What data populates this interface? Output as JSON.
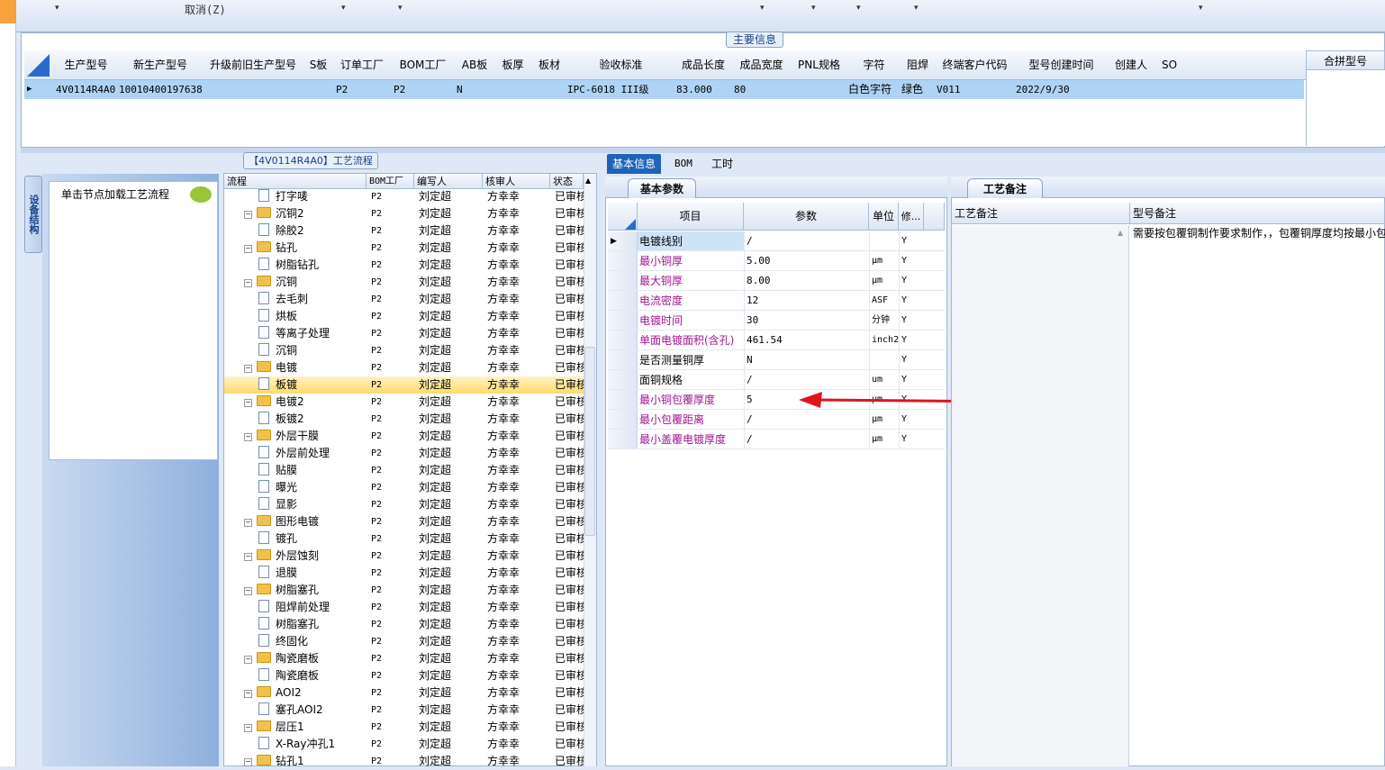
{
  "toolbar": {
    "cancel_label": "取消(Z)"
  },
  "main_info": {
    "title": "主要信息",
    "columns": [
      "生产型号",
      "新生产型号",
      "升级前旧生产型号",
      "S板",
      "订单工厂",
      "BOM工厂",
      "AB板",
      "板厚",
      "板材",
      "验收标准",
      "成品长度",
      "成品宽度",
      "PNL规格",
      "字符",
      "阻焊",
      "终端客户代码",
      "型号创建时间",
      "创建人",
      "SO"
    ],
    "row": {
      "prod_model": "4V0114R4A0",
      "new_prod_model": "10010400197638",
      "order_factory": "P2",
      "bom_factory": "P2",
      "ab_board": "N",
      "acceptance": "IPC-6018 III级",
      "length": "83.000",
      "width": "80",
      "char": "白色字符",
      "solder": "绿色",
      "customer_code": "V011",
      "created": "2022/9/30"
    },
    "merge_header": "合拼型号"
  },
  "process": {
    "title": "【4V0114R4A0】工艺流程",
    "device_tab": "设备结构",
    "load_hint": "单击节点加载工艺流程",
    "columns": [
      "流程",
      "BOM工厂",
      "编写人",
      "核审人",
      "状态"
    ],
    "rows": [
      {
        "name": "打字唛",
        "level": 2,
        "bom": "P2",
        "writer": "刘定超",
        "reviewer": "方幸幸",
        "status": "已审核"
      },
      {
        "name": "沉铜2",
        "level": 1,
        "bom": "P2",
        "writer": "刘定超",
        "reviewer": "方幸幸",
        "status": "已审核"
      },
      {
        "name": "除胶2",
        "level": 2,
        "bom": "P2",
        "writer": "刘定超",
        "reviewer": "方幸幸",
        "status": "已审核"
      },
      {
        "name": "钻孔",
        "level": 1,
        "bom": "P2",
        "writer": "刘定超",
        "reviewer": "方幸幸",
        "status": "已审核"
      },
      {
        "name": "树脂钻孔",
        "level": 2,
        "bom": "P2",
        "writer": "刘定超",
        "reviewer": "方幸幸",
        "status": "已审核"
      },
      {
        "name": "沉铜",
        "level": 1,
        "bom": "P2",
        "writer": "刘定超",
        "reviewer": "方幸幸",
        "status": "已审核"
      },
      {
        "name": "去毛刺",
        "level": 2,
        "bom": "P2",
        "writer": "刘定超",
        "reviewer": "方幸幸",
        "status": "已审核"
      },
      {
        "name": "烘板",
        "level": 2,
        "bom": "P2",
        "writer": "刘定超",
        "reviewer": "方幸幸",
        "status": "已审核"
      },
      {
        "name": "等离子处理",
        "level": 2,
        "bom": "P2",
        "writer": "刘定超",
        "reviewer": "方幸幸",
        "status": "已审核"
      },
      {
        "name": "沉铜",
        "level": 2,
        "bom": "P2",
        "writer": "刘定超",
        "reviewer": "方幸幸",
        "status": "已审核"
      },
      {
        "name": "电镀",
        "level": 1,
        "bom": "P2",
        "writer": "刘定超",
        "reviewer": "方幸幸",
        "status": "已审核"
      },
      {
        "name": "板镀",
        "level": 2,
        "bom": "P2",
        "writer": "刘定超",
        "reviewer": "方幸幸",
        "status": "已审核",
        "selected": true
      },
      {
        "name": "电镀2",
        "level": 1,
        "bom": "P2",
        "writer": "刘定超",
        "reviewer": "方幸幸",
        "status": "已审核"
      },
      {
        "name": "板镀2",
        "level": 2,
        "bom": "P2",
        "writer": "刘定超",
        "reviewer": "方幸幸",
        "status": "已审核"
      },
      {
        "name": "外层干膜",
        "level": 1,
        "bom": "P2",
        "writer": "刘定超",
        "reviewer": "方幸幸",
        "status": "已审核"
      },
      {
        "name": "外层前处理",
        "level": 2,
        "bom": "P2",
        "writer": "刘定超",
        "reviewer": "方幸幸",
        "status": "已审核"
      },
      {
        "name": "贴膜",
        "level": 2,
        "bom": "P2",
        "writer": "刘定超",
        "reviewer": "方幸幸",
        "status": "已审核"
      },
      {
        "name": "曝光",
        "level": 2,
        "bom": "P2",
        "writer": "刘定超",
        "reviewer": "方幸幸",
        "status": "已审核"
      },
      {
        "name": "显影",
        "level": 2,
        "bom": "P2",
        "writer": "刘定超",
        "reviewer": "方幸幸",
        "status": "已审核"
      },
      {
        "name": "图形电镀",
        "level": 1,
        "bom": "P2",
        "writer": "刘定超",
        "reviewer": "方幸幸",
        "status": "已审核"
      },
      {
        "name": "镀孔",
        "level": 2,
        "bom": "P2",
        "writer": "刘定超",
        "reviewer": "方幸幸",
        "status": "已审核"
      },
      {
        "name": "外层蚀刻",
        "level": 1,
        "bom": "P2",
        "writer": "刘定超",
        "reviewer": "方幸幸",
        "status": "已审核"
      },
      {
        "name": "退膜",
        "level": 2,
        "bom": "P2",
        "writer": "刘定超",
        "reviewer": "方幸幸",
        "status": "已审核"
      },
      {
        "name": "树脂塞孔",
        "level": 1,
        "bom": "P2",
        "writer": "刘定超",
        "reviewer": "方幸幸",
        "status": "已审核"
      },
      {
        "name": "阻焊前处理",
        "level": 2,
        "bom": "P2",
        "writer": "刘定超",
        "reviewer": "方幸幸",
        "status": "已审核"
      },
      {
        "name": "树脂塞孔",
        "level": 2,
        "bom": "P2",
        "writer": "刘定超",
        "reviewer": "方幸幸",
        "status": "已审核"
      },
      {
        "name": "终固化",
        "level": 2,
        "bom": "P2",
        "writer": "刘定超",
        "reviewer": "方幸幸",
        "status": "已审核"
      },
      {
        "name": "陶瓷磨板",
        "level": 1,
        "bom": "P2",
        "writer": "刘定超",
        "reviewer": "方幸幸",
        "status": "已审核"
      },
      {
        "name": "陶瓷磨板",
        "level": 2,
        "bom": "P2",
        "writer": "刘定超",
        "reviewer": "方幸幸",
        "status": "已审核"
      },
      {
        "name": "AOI2",
        "level": 1,
        "bom": "P2",
        "writer": "刘定超",
        "reviewer": "方幸幸",
        "status": "已审核"
      },
      {
        "name": "塞孔AOI2",
        "level": 2,
        "bom": "P2",
        "writer": "刘定超",
        "reviewer": "方幸幸",
        "status": "已审核"
      },
      {
        "name": "层压1",
        "level": 1,
        "bom": "P2",
        "writer": "刘定超",
        "reviewer": "方幸幸",
        "status": "已审核"
      },
      {
        "name": "X-Ray冲孔1",
        "level": 2,
        "bom": "P2",
        "writer": "刘定超",
        "reviewer": "方幸幸",
        "status": "已审核"
      },
      {
        "name": "钻孔1",
        "level": 1,
        "bom": "P2",
        "writer": "刘定超",
        "reviewer": "方幸幸",
        "status": "已审核"
      }
    ]
  },
  "tabs": [
    "基本信息",
    "BOM",
    "工时"
  ],
  "basic_params": {
    "tab_label": "基本参数",
    "columns": [
      "项目",
      "参数",
      "单位",
      "修..."
    ],
    "rows": [
      {
        "item": "电镀线别",
        "value": "/",
        "unit": "",
        "mod": "Y",
        "magenta": false,
        "highlight": true
      },
      {
        "item": "最小铜厚",
        "value": "5.00",
        "unit": "μm",
        "mod": "Y",
        "magenta": true
      },
      {
        "item": "最大铜厚",
        "value": "8.00",
        "unit": "μm",
        "mod": "Y",
        "magenta": true
      },
      {
        "item": "电流密度",
        "value": "12",
        "unit": "ASF",
        "mod": "Y",
        "magenta": true
      },
      {
        "item": "电镀时间",
        "value": "30",
        "unit": "分钟",
        "mod": "Y",
        "magenta": true
      },
      {
        "item": "单面电镀面积(含孔)",
        "value": "461.54",
        "unit": "inch2",
        "mod": "Y",
        "magenta": true
      },
      {
        "item": "是否测量铜厚",
        "value": "N",
        "unit": "",
        "mod": "Y",
        "magenta": false
      },
      {
        "item": "面铜规格",
        "value": "/",
        "unit": "um",
        "mod": "Y",
        "magenta": false
      },
      {
        "item": "最小铜包覆厚度",
        "value": "5",
        "unit": "μm",
        "mod": "Y",
        "magenta": true
      },
      {
        "item": "最小包覆距离",
        "value": "/",
        "unit": "μm",
        "mod": "Y",
        "magenta": true
      },
      {
        "item": "最小盖覆电镀厚度",
        "value": "/",
        "unit": "μm",
        "mod": "Y",
        "magenta": true
      }
    ]
  },
  "remarks": {
    "tab_label": "工艺备注",
    "col1": "工艺备注",
    "col2": "型号备注",
    "model_remark": "需要按包覆铜制作要求制作，，包覆铜厚度均按最小包覆铜厚度"
  },
  "colors": {
    "accent": "#1f63b8",
    "selected_row": "#aed3f5",
    "tree_selected": "#ffd96a",
    "magenta": "#a0158f",
    "arrow": "#e0141c"
  }
}
